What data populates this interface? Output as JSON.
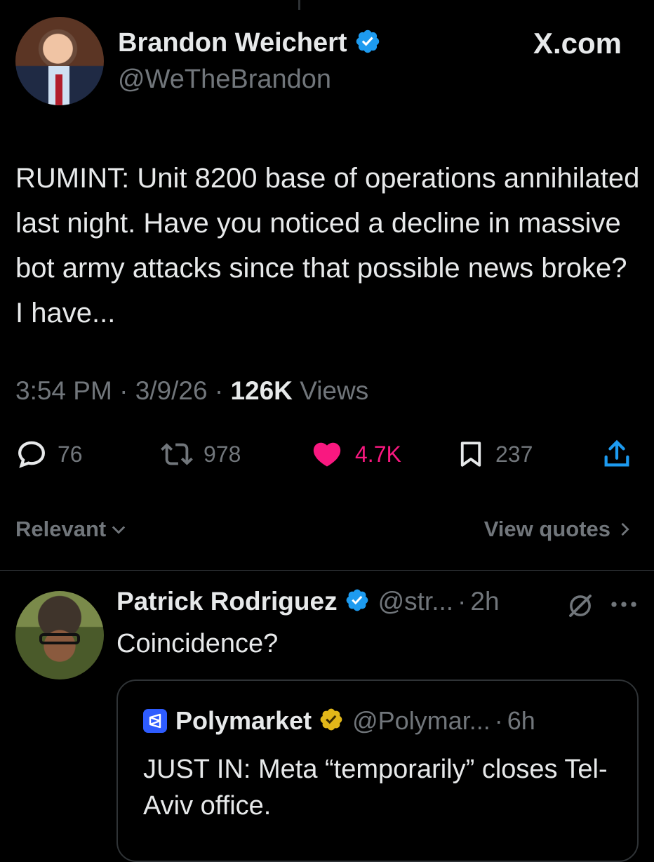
{
  "header": {
    "author_name": "Brandon Weichert",
    "author_handle": "@WeTheBrandon",
    "source_label": "X.com"
  },
  "tweet": {
    "text": "RUMINT: Unit 8200 base of operations annihilated last night. Have you noticed a decline in massive bot army attacks since that possible news broke? I have...",
    "time": "3:54 PM",
    "date": "3/9/26",
    "views_count": "126K",
    "views_label": "Views"
  },
  "actions": {
    "replies": "76",
    "reposts": "978",
    "likes": "4.7K",
    "bookmarks": "237"
  },
  "sort": {
    "relevant_label": "Relevant",
    "view_quotes_label": "View quotes"
  },
  "reply": {
    "author_name": "Patrick Rodriguez",
    "author_handle": "@str...",
    "time": "2h",
    "text": "Coincidence?"
  },
  "quote": {
    "author_name": "Polymarket",
    "author_handle": "@Polymar...",
    "time": "6h",
    "text": "JUST IN: Meta “temporarily” closes Tel-Aviv office."
  },
  "colors": {
    "background": "#000000",
    "text_primary": "#e7e9ea",
    "text_secondary": "#71767b",
    "verified_blue": "#1d9bf0",
    "verified_gold": "#e2b719",
    "like_pink": "#f91880",
    "polymarket_blue": "#2e5cff"
  },
  "icons": [
    "verified-badge-icon",
    "reply-icon",
    "repost-icon",
    "heart-icon",
    "bookmark-icon",
    "share-icon",
    "chevron-down-icon",
    "chevron-right-icon",
    "grok-icon",
    "more-icon",
    "polymarket-logo-icon",
    "gold-verified-badge-icon"
  ]
}
